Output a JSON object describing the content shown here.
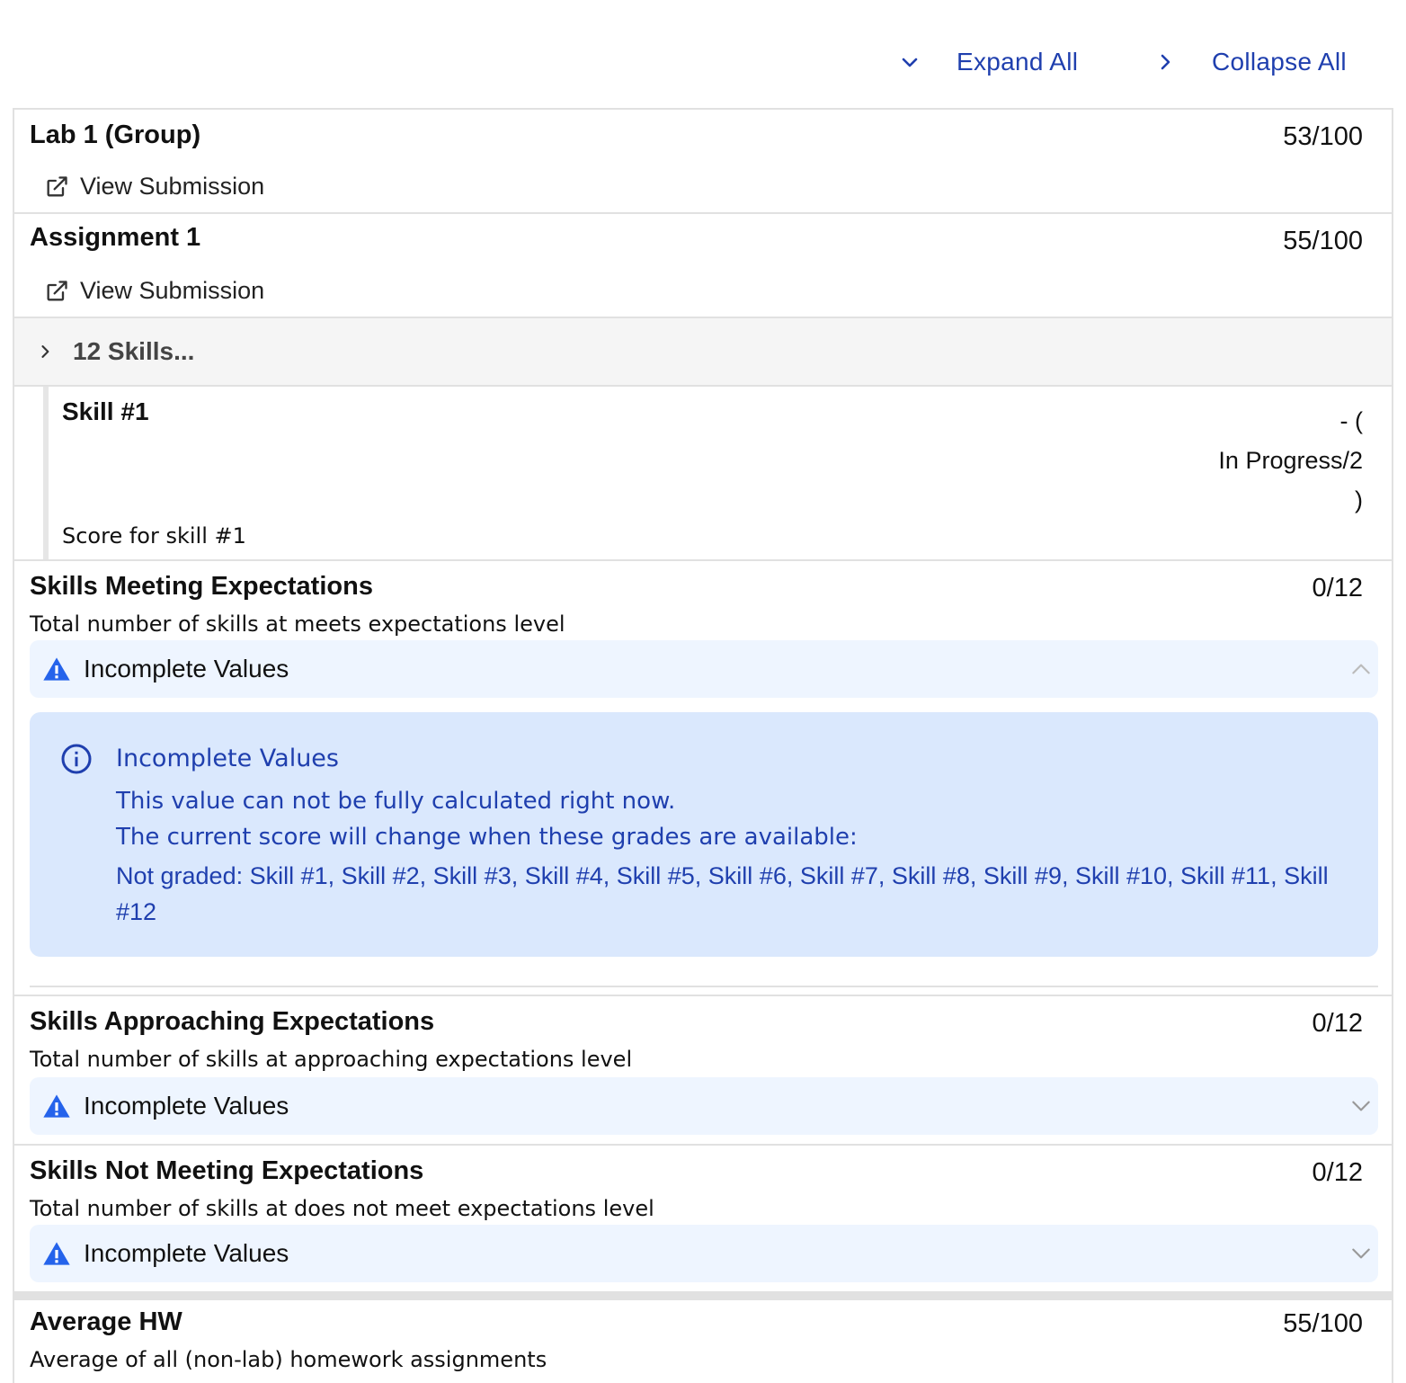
{
  "toolbar": {
    "expand_label": "Expand All",
    "collapse_label": "Collapse All"
  },
  "items": [
    {
      "title": "Lab 1 (Group)",
      "score": "53/100",
      "link": "View Submission"
    },
    {
      "title": "Assignment 1",
      "score": "55/100",
      "link": "View Submission"
    }
  ],
  "skills_group": {
    "label": "12 Skills...",
    "skill": {
      "title": "Skill #1",
      "score_line1": "- (",
      "score_line2": "In Progress/2",
      "score_line3": ")",
      "description": "Score for skill #1"
    }
  },
  "meeting": {
    "title": "Skills Meeting Expectations",
    "score": "0/12",
    "description": "Total number of skills at meets expectations level",
    "warning": "Incomplete Values",
    "info_title": "Incomplete Values",
    "info_line1": "This value can not be fully calculated right now.",
    "info_line2": "The current score will change when these grades are available:",
    "info_not_graded": "Not graded: Skill #1, Skill #2, Skill #3, Skill #4, Skill #5, Skill #6, Skill #7, Skill #8, Skill #9, Skill #10, Skill #11, Skill #12"
  },
  "approaching": {
    "title": "Skills Approaching Expectations",
    "score": "0/12",
    "description": "Total number of skills at approaching expectations level",
    "warning": "Incomplete Values"
  },
  "not_meeting": {
    "title": "Skills Not Meeting Expectations",
    "score": "0/12",
    "description": "Total number of skills at does not meet expectations level",
    "warning": "Incomplete Values"
  },
  "average_hw": {
    "title": "Average HW",
    "score": "55/100",
    "description": "Average of all (non-lab) homework assignments"
  },
  "colors": {
    "link_blue": "#1f3fae",
    "warning_icon": "#2563eb",
    "warning_bg": "#eef5ff",
    "info_bg": "#dae8fd",
    "border": "#e1e1e1"
  },
  "icons": {
    "expand": "chevron-down-icon",
    "collapse": "chevron-right-icon",
    "view_submission": "external-link-icon",
    "warning": "warning-triangle-icon",
    "info": "info-circle-icon"
  }
}
